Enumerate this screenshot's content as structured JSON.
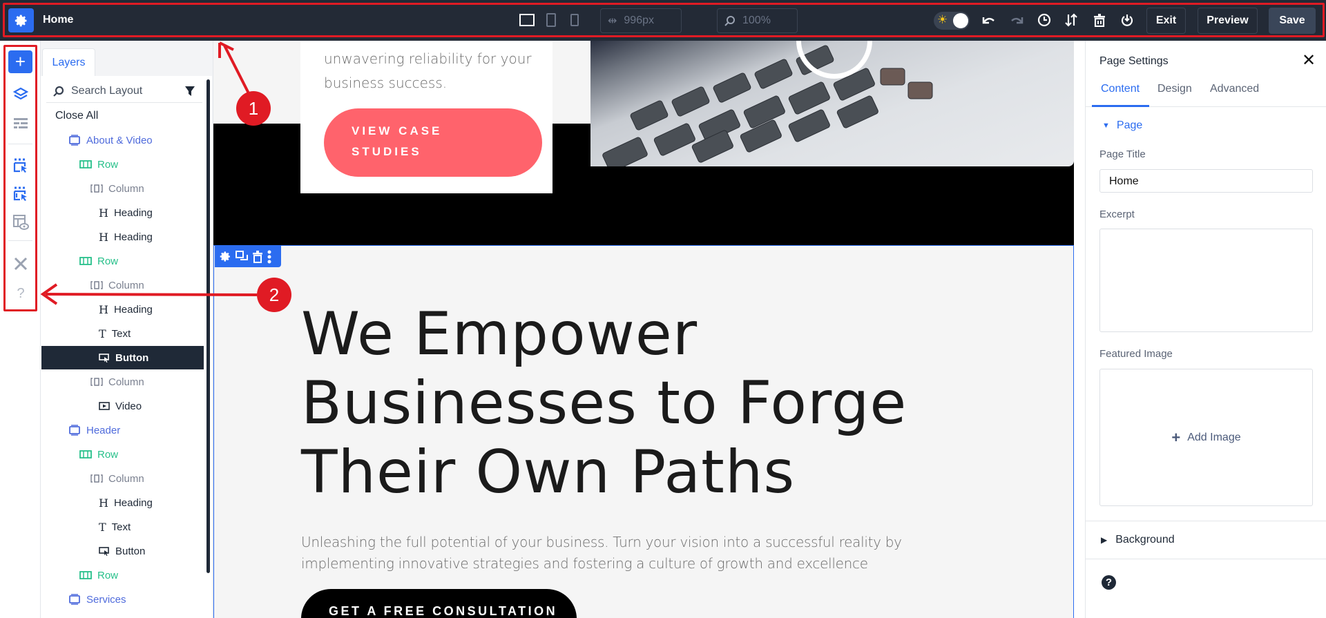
{
  "topbar": {
    "page_name": "Home",
    "width_value": "996px",
    "zoom_value": "100%",
    "exit_label": "Exit",
    "preview_label": "Preview",
    "save_label": "Save",
    "icons": [
      "gear-icon",
      "desktop-icon",
      "tablet-icon",
      "phone-icon",
      "width-icon",
      "zoom-icon",
      "theme-toggle",
      "undo-icon",
      "redo-icon",
      "history-icon",
      "sort-icon",
      "trash-icon",
      "power-icon"
    ]
  },
  "rail": {
    "icons": [
      "add-icon",
      "layers-icon",
      "layout-icon",
      "select-module-icon",
      "select-multiple-icon",
      "preview-layout-icon",
      "tools-icon",
      "help-icon"
    ]
  },
  "layers": {
    "tab_label": "Layers",
    "search_placeholder": "Search Layout",
    "close_all": "Close All",
    "items": [
      {
        "label": "About & Video",
        "type": "section"
      },
      {
        "label": "Row",
        "type": "row"
      },
      {
        "label": "Column",
        "type": "column"
      },
      {
        "label": "Heading",
        "type": "heading"
      },
      {
        "label": "Heading",
        "type": "heading"
      },
      {
        "label": "Row",
        "type": "row"
      },
      {
        "label": "Column",
        "type": "column"
      },
      {
        "label": "Heading",
        "type": "heading"
      },
      {
        "label": "Text",
        "type": "text"
      },
      {
        "label": "Button",
        "type": "button",
        "selected": true
      },
      {
        "label": "Column",
        "type": "column"
      },
      {
        "label": "Video",
        "type": "video"
      },
      {
        "label": "Header",
        "type": "section"
      },
      {
        "label": "Row",
        "type": "row"
      },
      {
        "label": "Column",
        "type": "column"
      },
      {
        "label": "Heading",
        "type": "heading"
      },
      {
        "label": "Text",
        "type": "text"
      },
      {
        "label": "Button",
        "type": "button"
      },
      {
        "label": "Row",
        "type": "row"
      },
      {
        "label": "Services",
        "type": "section"
      }
    ]
  },
  "canvas": {
    "card_text_line1": "unwavering reliability for your",
    "card_text_line2": "business success.",
    "case_button_line1": "VIEW CASE",
    "case_button_line2": "STUDIES",
    "hero_line1": "We Empower",
    "hero_line2": "Businesses to Forge",
    "hero_line3": "Their Own Paths",
    "hero_para_line1": "Unleashing the full potential of your business. Turn your vision into a successful reality by",
    "hero_para_line2": "implementing innovative strategies and fostering a culture of growth and excellence",
    "cta_label": "GET A FREE CONSULTATION"
  },
  "settings": {
    "title": "Page Settings",
    "tabs": [
      "Content",
      "Design",
      "Advanced"
    ],
    "active_tab": "Content",
    "group_page": "Page",
    "page_title_label": "Page Title",
    "page_title_value": "Home",
    "excerpt_label": "Excerpt",
    "excerpt_value": "",
    "featured_image_label": "Featured Image",
    "add_image_label": "Add Image",
    "group_background": "Background"
  },
  "annotations": [
    "1",
    "2"
  ],
  "colors": {
    "topbar": "#232a36",
    "accent": "#2b6cf0",
    "section": "#4f6bdc",
    "row": "#27c08a",
    "column": "#7b8190",
    "pink_button": "#ff636c",
    "annotation": "#e01b24"
  }
}
